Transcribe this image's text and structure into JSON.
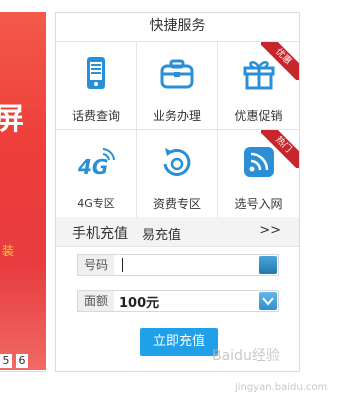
{
  "banner": {
    "big_text": "屏",
    "small_text": "装",
    "pages": [
      "5",
      "6"
    ]
  },
  "panel": {
    "title": "快捷服务",
    "services": [
      {
        "label": "话费查询",
        "icon": "phone-icon",
        "ribbon": ""
      },
      {
        "label": "业务办理",
        "icon": "briefcase-icon",
        "ribbon": ""
      },
      {
        "label": "优惠促销",
        "icon": "gift-icon",
        "ribbon": "优惠"
      },
      {
        "label": "4G专区",
        "icon": "4g-icon",
        "ribbon": ""
      },
      {
        "label": "资费专区",
        "icon": "refresh-icon",
        "ribbon": ""
      },
      {
        "label": "选号入网",
        "icon": "signal-icon",
        "ribbon": "热门"
      }
    ]
  },
  "recharge": {
    "tab_mobile": "手机充值",
    "tab_easy": "易充值",
    "more": ">>",
    "number_label": "号码",
    "amount_label": "面额",
    "amount_value": "100元",
    "submit_label": "立即充值"
  },
  "watermark": {
    "brand": "Baidu经验",
    "url": "jingyan.baidu.com"
  },
  "colors": {
    "accent_blue": "#1fa0e8",
    "highlight_red": "#d8262b",
    "banner_red": "#ee3f3a"
  }
}
